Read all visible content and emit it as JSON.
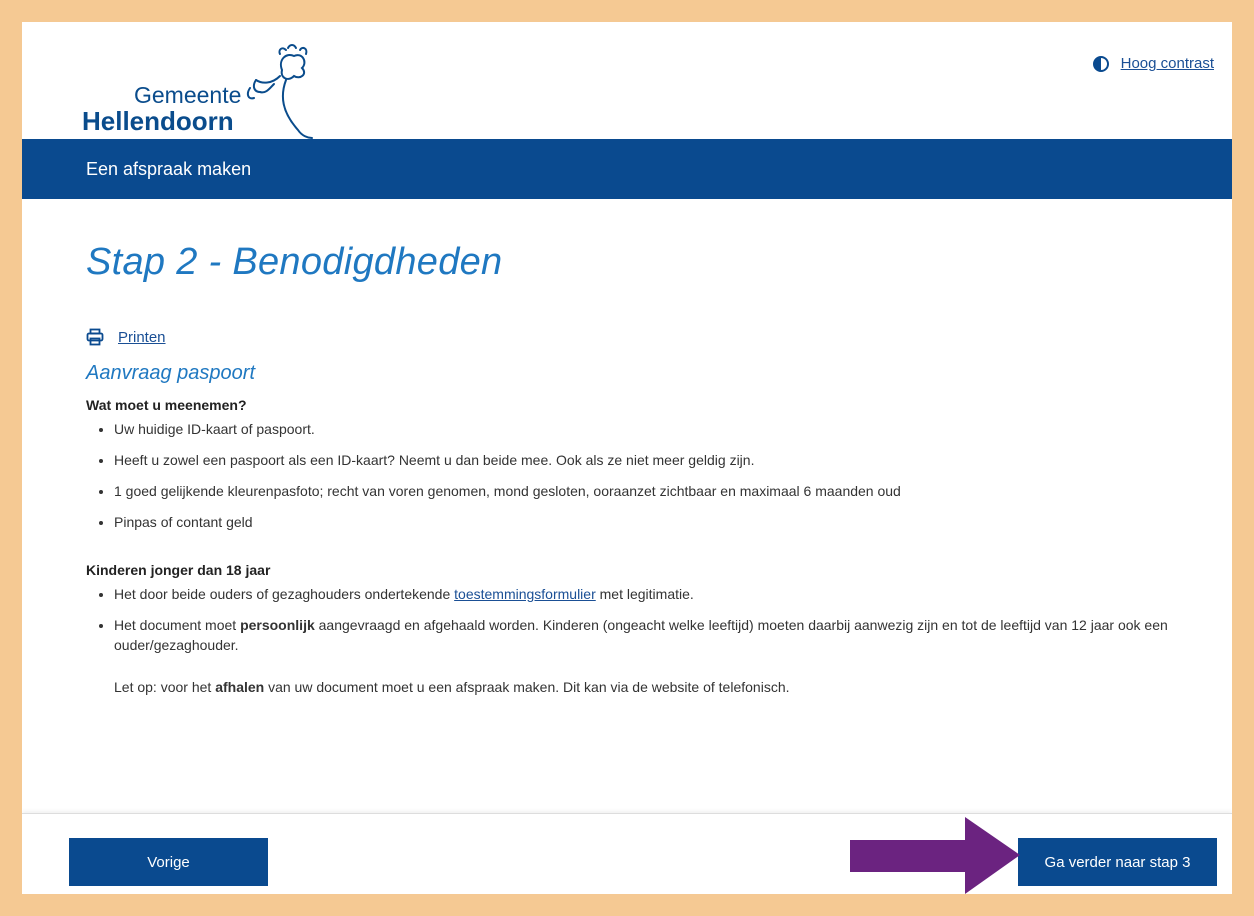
{
  "logo": {
    "line1": "Gemeente",
    "line2": "Hellendoorn"
  },
  "contrast": {
    "label": "Hoog contrast",
    "icon": "contrast-icon"
  },
  "nav": {
    "title": "Een afspraak maken"
  },
  "page": {
    "title": "Stap 2 - Benodigdheden",
    "print_label": "Printen",
    "section_title": "Aanvraag paspoort",
    "bring": {
      "heading": "Wat moet u meenemen?",
      "items": [
        "Uw huidige ID-kaart of paspoort.",
        "Heeft u zowel een paspoort als een ID-kaart? Neemt u dan beide mee. Ook als ze niet meer geldig zijn.",
        "1 goed gelijkende kleurenpasfoto; recht van voren genomen, mond gesloten, ooraanzet zichtbaar en maximaal 6 maanden oud",
        "Pinpas of contant geld"
      ]
    },
    "children": {
      "heading": "Kinderen jonger dan 18 jaar",
      "item1_prefix": "Het door beide ouders of gezaghouders ondertekende ",
      "item1_link": "toestemmingsformulier",
      "item1_suffix": " met legitimatie.",
      "item2_prefix": "Het document moet ",
      "item2_bold": "persoonlijk",
      "item2_suffix": " aangevraagd en afgehaald worden. Kinderen (ongeacht welke leeftijd) moeten daarbij aanwezig zijn en tot de leeftijd van 12 jaar ook een ouder/gezaghouder.",
      "note_prefix": "Let op: voor het ",
      "note_bold": "afhalen",
      "note_suffix": " van uw document moet u een afspraak maken. Dit kan via de website of telefonisch."
    }
  },
  "footer": {
    "prev_label": "Vorige",
    "next_label": "Ga verder naar stap 3"
  },
  "colors": {
    "brand": "#0a4a8f",
    "title": "#1f78c1",
    "frame": "#f5c993",
    "arrow": "#6b2380"
  }
}
